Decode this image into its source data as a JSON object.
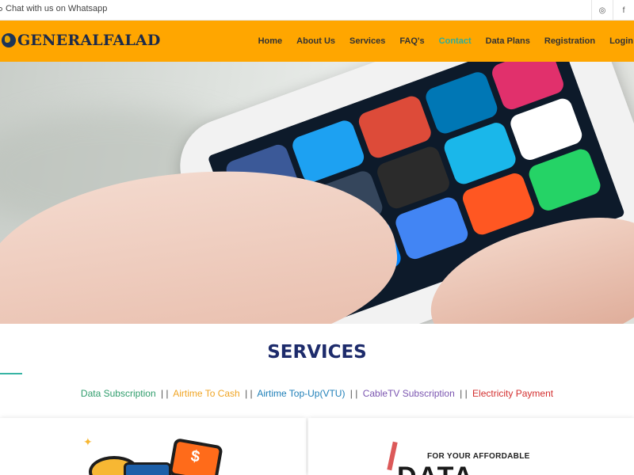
{
  "topbar": {
    "chat_text": "Chat with us on Whatsapp",
    "social": [
      {
        "icon": "whatsapp-icon",
        "glyph": "◎"
      },
      {
        "icon": "facebook-icon",
        "glyph": "f"
      }
    ]
  },
  "brand": {
    "name": "GENERALFALAD"
  },
  "nav": {
    "items": [
      {
        "label": "Home"
      },
      {
        "label": "About Us"
      },
      {
        "label": "Services"
      },
      {
        "label": "FAQ's"
      },
      {
        "label": "Contact",
        "active": true
      },
      {
        "label": "Data Plans"
      },
      {
        "label": "Registration"
      },
      {
        "label": "Login"
      }
    ]
  },
  "hero": {
    "slide_count": 3,
    "active_slide": 2
  },
  "services": {
    "title": "SERVICES",
    "links": [
      {
        "label": "Data Subscription"
      },
      {
        "label": "Airtime To Cash"
      },
      {
        "label": "Airtime Top-Up(VTU)"
      },
      {
        "label": "CableTV Subscription"
      },
      {
        "label": "Electricity Payment"
      }
    ],
    "separator": "| |"
  },
  "cards": {
    "left": {
      "symbol": "$"
    },
    "right": {
      "small_text": "FOR YOUR AFFORDABLE",
      "big_text": "DATA"
    }
  },
  "colors": {
    "navbar": "#ffa600",
    "active_link": "#2fae9a",
    "title": "#1d2b6b"
  }
}
